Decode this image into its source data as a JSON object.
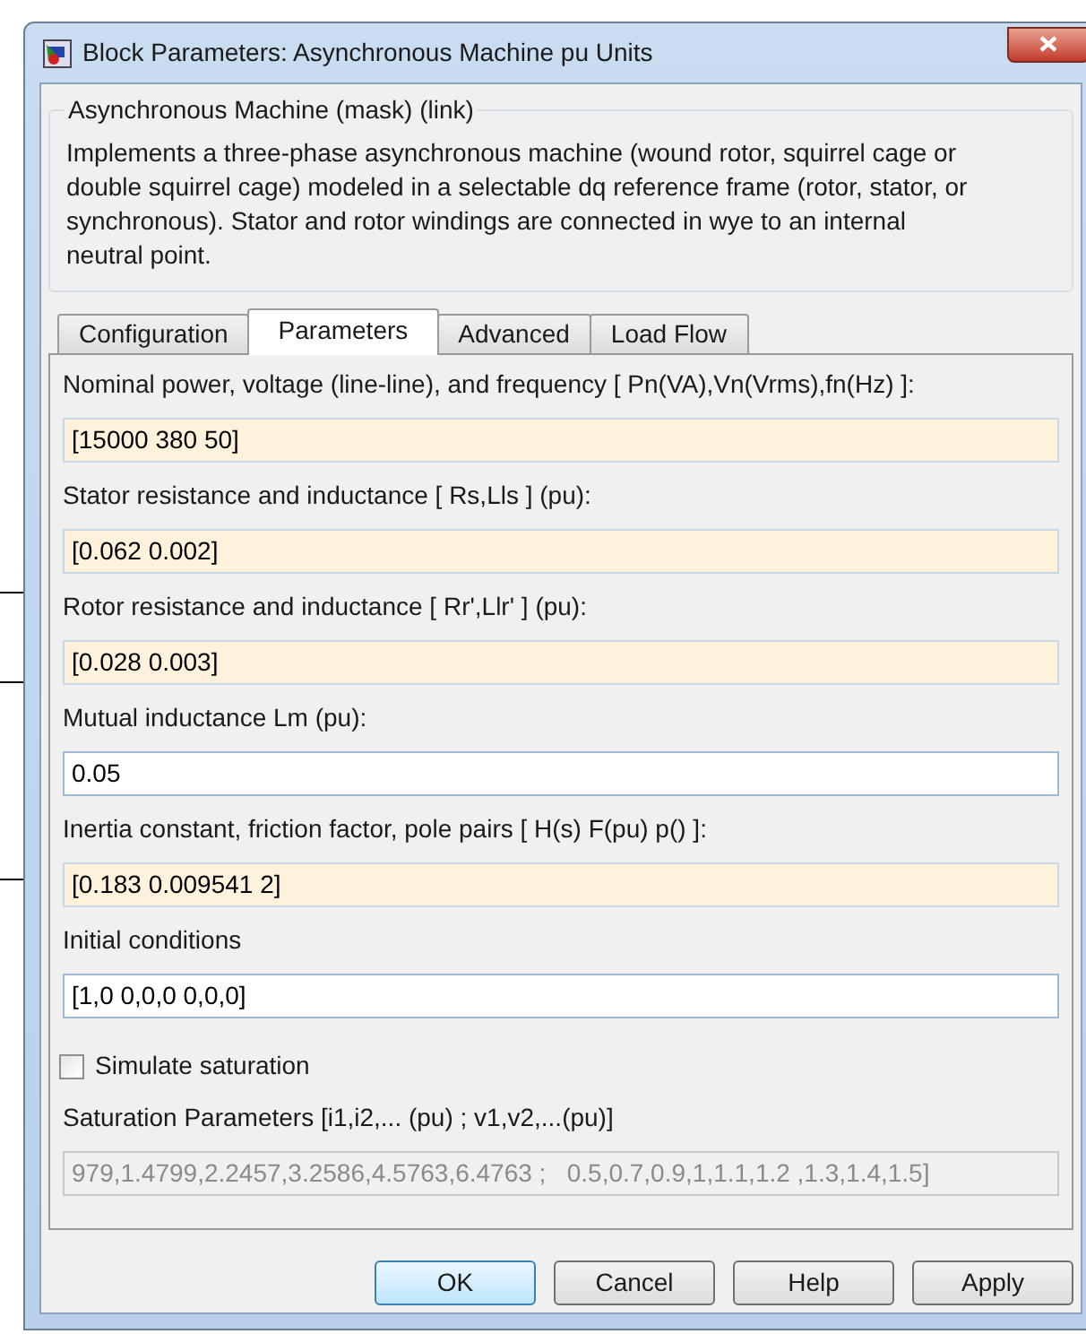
{
  "window": {
    "title": "Block Parameters: Asynchronous Machine pu Units"
  },
  "group": {
    "title": "Asynchronous Machine (mask) (link)",
    "description": "Implements a three-phase asynchronous machine (wound rotor, squirrel cage or double squirrel cage) modeled in a selectable dq reference frame (rotor, stator, or synchronous). Stator and rotor windings are connected in wye to an internal neutral point."
  },
  "tabs": [
    {
      "label": "Configuration",
      "selected": false
    },
    {
      "label": "Parameters",
      "selected": true
    },
    {
      "label": "Advanced",
      "selected": false
    },
    {
      "label": "Load Flow",
      "selected": false
    }
  ],
  "parameters": [
    {
      "kind": "field",
      "label": "Nominal power, voltage (line-line), and frequency  [ Pn(VA),Vn(Vrms),fn(Hz) ]:",
      "value": "[15000 380 50]",
      "highlighted": true,
      "disabled": false
    },
    {
      "kind": "field",
      "label": "Stator resistance and inductance  [ Rs,Lls ] (pu):",
      "value": "[0.062 0.002]",
      "highlighted": true,
      "disabled": false
    },
    {
      "kind": "field",
      "label": "Rotor resistance and inductance  [ Rr',Llr' ] (pu):",
      "value": "[0.028 0.003]",
      "highlighted": true,
      "disabled": false
    },
    {
      "kind": "field",
      "label": "Mutual inductance Lm (pu):",
      "value": "0.05",
      "highlighted": false,
      "disabled": false
    },
    {
      "kind": "field",
      "label": "Inertia constant, friction factor, pole pairs [ H(s) F(pu)  p() ]:",
      "value": "[0.183 0.009541 2]",
      "highlighted": true,
      "disabled": false
    },
    {
      "kind": "field",
      "label": "Initial conditions",
      "value": "[1,0 0,0,0 0,0,0]",
      "highlighted": false,
      "disabled": false
    },
    {
      "kind": "checkbox",
      "label": "Simulate saturation",
      "checked": false
    },
    {
      "kind": "field",
      "label": "Saturation Parameters [i1,i2,... (pu) ; v1,v2,...(pu)]",
      "value": "979,1.4799,2.2457,3.2586,4.5763,6.4763 ;   0.5,0.7,0.9,1,1.1,1.2 ,1.3,1.4,1.5]",
      "disabled": true
    }
  ],
  "buttons": [
    {
      "label": "OK",
      "default": true
    },
    {
      "label": "Cancel",
      "default": false
    },
    {
      "label": "Help",
      "default": false
    },
    {
      "label": "Apply",
      "default": false
    }
  ]
}
